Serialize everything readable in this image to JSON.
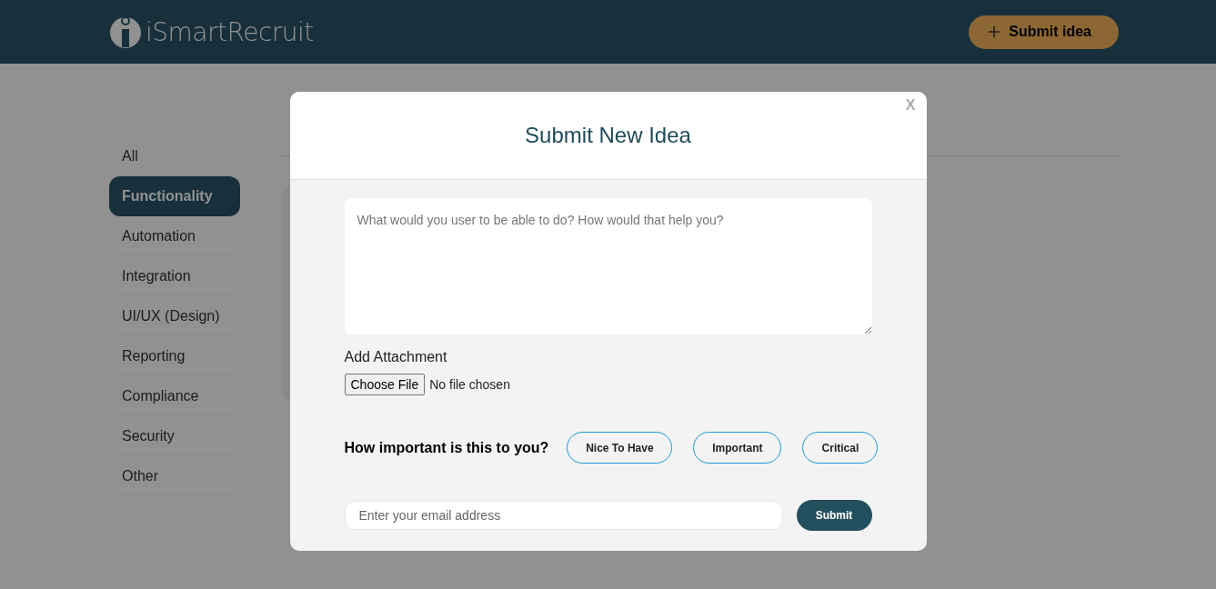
{
  "header": {
    "logo_text": "iSmartRecruit",
    "submit_button": "Submit idea"
  },
  "sidebar": {
    "items": [
      {
        "label": "All",
        "selected": false
      },
      {
        "label": "Functionality",
        "selected": true
      },
      {
        "label": "Automation",
        "selected": false
      },
      {
        "label": "Integration",
        "selected": false
      },
      {
        "label": "UI/UX (Design)",
        "selected": false
      },
      {
        "label": "Reporting",
        "selected": false
      },
      {
        "label": "Compliance",
        "selected": false
      },
      {
        "label": "Security",
        "selected": false
      },
      {
        "label": "Other",
        "selected": false
      }
    ]
  },
  "modal": {
    "title": "Submit New Idea",
    "close": "X",
    "idea": {
      "placeholder": "What would you user to be able to do? How would that help you?"
    },
    "attachment": {
      "label": "Add Attachment",
      "button": "Choose File",
      "status": "No file chosen"
    },
    "importance": {
      "question": "How important is this to you?",
      "options": [
        {
          "label": "Nice To Have",
          "selected": false
        },
        {
          "label": "Important",
          "selected": false
        },
        {
          "label": "Critical",
          "selected": false
        }
      ]
    },
    "email": {
      "placeholder": "Enter your email address"
    },
    "submit": "Submit"
  }
}
